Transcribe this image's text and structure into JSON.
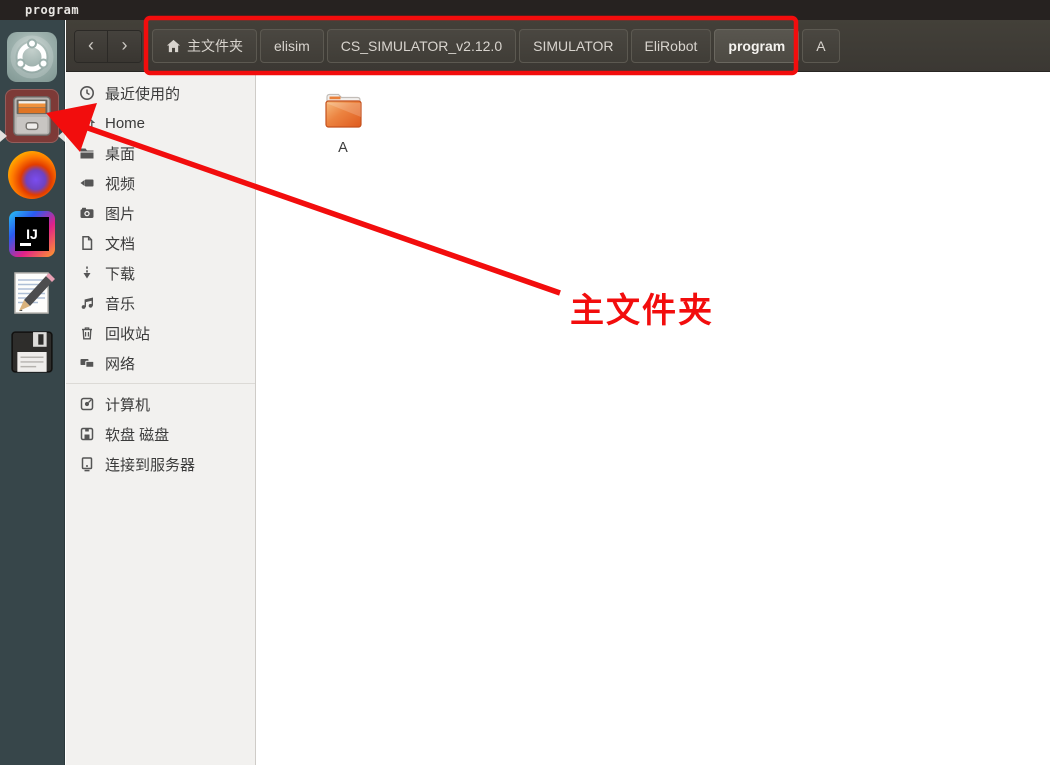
{
  "topbar": {
    "title": "program"
  },
  "dock": {
    "icons": [
      {
        "name": "ubuntu-dash"
      },
      {
        "name": "files",
        "active": true
      },
      {
        "name": "firefox"
      },
      {
        "name": "intellij-idea"
      },
      {
        "name": "text-editor"
      },
      {
        "name": "floppy-disk"
      }
    ]
  },
  "window": {
    "nav": {
      "back_label": "‹",
      "forward_label": "›"
    },
    "breadcrumbs": [
      {
        "label": "主文件夹"
      },
      {
        "label": "elisim"
      },
      {
        "label": "CS_SIMULATOR_v2.12.0"
      },
      {
        "label": "SIMULATOR"
      },
      {
        "label": "EliRobot"
      },
      {
        "label": "program",
        "active": true
      },
      {
        "label": "A"
      }
    ],
    "sidebar": {
      "places": [
        {
          "label": "最近使用的",
          "icon": "recent-icon"
        },
        {
          "label": "Home",
          "icon": "home-icon"
        },
        {
          "label": "桌面",
          "icon": "desktop-icon"
        },
        {
          "label": "视频",
          "icon": "videos-icon"
        },
        {
          "label": "图片",
          "icon": "pictures-icon"
        },
        {
          "label": "文档",
          "icon": "documents-icon"
        },
        {
          "label": "下载",
          "icon": "downloads-icon"
        },
        {
          "label": "音乐",
          "icon": "music-icon"
        },
        {
          "label": "回收站",
          "icon": "trash-icon"
        },
        {
          "label": "网络",
          "icon": "network-icon"
        }
      ],
      "devices": [
        {
          "label": "计算机",
          "icon": "computer-icon"
        },
        {
          "label": "软盘 磁盘",
          "icon": "floppy-icon"
        },
        {
          "label": "连接到服务器",
          "icon": "server-icon"
        }
      ]
    },
    "main": {
      "files": [
        {
          "label": "A",
          "type": "folder"
        }
      ]
    }
  },
  "annotations": {
    "callout_text": "主文件夹",
    "color": "#f20d0d"
  },
  "colors": {
    "topbar_bg": "#262220",
    "dock_bg": "#37464a",
    "active_app_bg": "#7d3a37",
    "headerbar_bg": "#403d39",
    "sidebar_bg": "#f2f1ef",
    "folder_orange": "#e2641f",
    "annotation_red": "#f20d0d"
  }
}
